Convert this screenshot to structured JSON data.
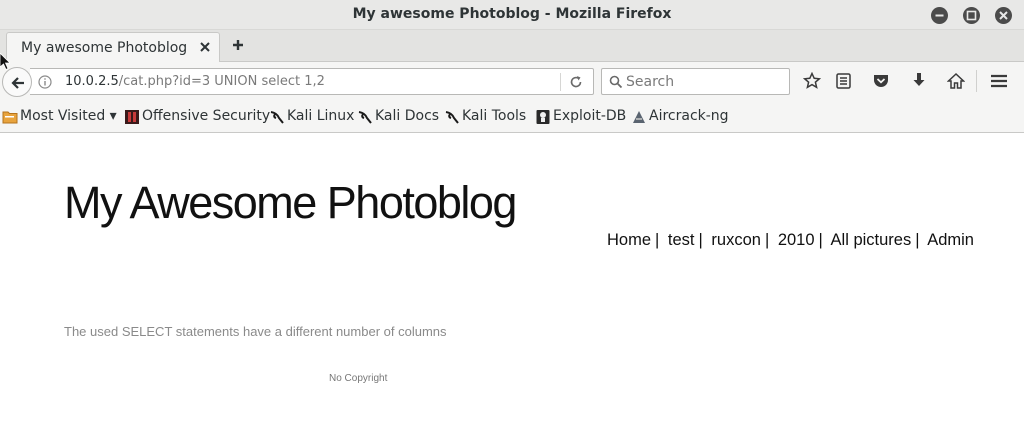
{
  "window": {
    "title": "My awesome Photoblog - Mozilla Firefox"
  },
  "tabs": [
    {
      "label": "My awesome Photoblog"
    }
  ],
  "address_bar": {
    "host": "10.0.2.5",
    "path": "/cat.php?id=3 UNION select 1,2"
  },
  "search": {
    "placeholder": "Search"
  },
  "bookmarks": [
    {
      "label": "Most Visited ▾",
      "icon": "folder-icon"
    },
    {
      "label": "Offensive Security",
      "icon": "offsec-icon"
    },
    {
      "label": "Kali Linux",
      "icon": "kali-icon"
    },
    {
      "label": "Kali Docs",
      "icon": "kali-icon"
    },
    {
      "label": "Kali Tools",
      "icon": "kali-icon"
    },
    {
      "label": "Exploit-DB",
      "icon": "exploitdb-icon"
    },
    {
      "label": "Aircrack-ng",
      "icon": "aircrack-icon"
    }
  ],
  "page": {
    "site_title": "My Awesome Photoblog",
    "nav": [
      "Home",
      "test",
      "ruxcon",
      "2010",
      "All pictures",
      "Admin"
    ],
    "error_message": "The used SELECT statements have a different number of columns",
    "footer": "No Copyright"
  },
  "colors": {
    "titlebar_bg": "#e8e8e7",
    "toolbar_bg": "#f5f5f4",
    "window_button": "#4b4b4b",
    "error_text": "#8a8a8a"
  }
}
